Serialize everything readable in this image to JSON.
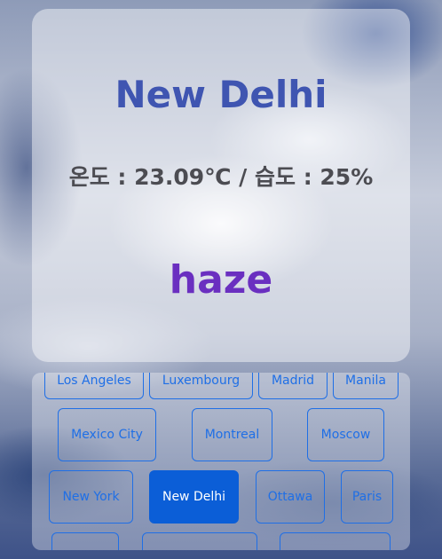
{
  "weather": {
    "city": "New Delhi",
    "stats_line": "온도 : 23.09℃ / 습도 : 25%",
    "condition": "haze"
  },
  "cities": {
    "row1": [
      "Los Angeles",
      "Luxembourg",
      "Madrid",
      "Manila"
    ],
    "row2": [
      "Mexico City",
      "Montreal",
      "Moscow"
    ],
    "row3": [
      "New York",
      "New Delhi",
      "Ottawa",
      "Paris"
    ],
    "row4": [
      "",
      "",
      ""
    ],
    "selected": "New Delhi"
  },
  "colors": {
    "city_title": "#3f55b1",
    "condition": "#6a2fc0",
    "accent": "#0b5ed7"
  }
}
